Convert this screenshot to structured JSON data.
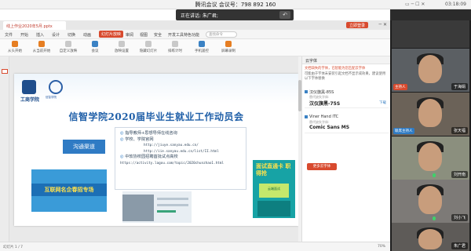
{
  "meeting": {
    "title": "腾讯会议 会议号：798 892 160",
    "clock": "03:18:09",
    "speaking_label": "正在讲话: 朱广君;"
  },
  "wps": {
    "doc_tab": "线上作业2020年5月.pptx",
    "right_tab_btn": "立即登录",
    "menu": [
      "文件",
      "开始",
      "插入",
      "设计",
      "切换",
      "动画",
      "幻灯片放映",
      "审阅",
      "视图",
      "安全",
      "开发工具",
      "特色功能"
    ],
    "menu_active_index": 6,
    "search_placeholder": "查找命令",
    "tools": [
      "从头开始",
      "从当前开始",
      "自定义放映",
      "会议",
      "放映设置",
      "隐藏幻灯片",
      "排练计时",
      "手机遥控",
      "屏幕录制"
    ],
    "zoom": "70%",
    "status_left": "幻灯片 1 / 7"
  },
  "slide": {
    "logo_text_1": "工商学院",
    "logo_text_2": "信智学院",
    "title": "信智学院2020届毕业生就业工作动员会",
    "channel_button": "沟通渠道",
    "bullets": [
      "指导教师+思想导师在线咨询",
      "学校、学院官网"
    ],
    "urls": [
      "http://jiuye.sanyau.edu.cn/",
      "http://iie.sanyau.edu.cn/list/II.html"
    ],
    "bullet3": "中软协校园招聘首批试点高校",
    "url3": "https://activity.lagou.com/topic/2020chunzhao1.html",
    "banner_left_text": "互联网名企春招专场",
    "banner_right_text": "面试直通卡 职得抢",
    "banner_right_sub": "云端面试"
  },
  "font_panel": {
    "title": "云字体",
    "warning": "文档缺失的字体，已智能为您匹配云字体",
    "desc": "可能由于字体未安装引起文档不显示或效果，建议使用以下字体替换",
    "fonts": [
      {
        "name": "汉仪旗黑-85S",
        "sub": "替代缺失字体:",
        "pick": "汉仪旗黑-75S",
        "action": "下载"
      },
      {
        "name": "Viner Hand ITC",
        "sub": "替代缺失字体:",
        "pick": "Comic Sans MS",
        "action": ""
      }
    ],
    "button": "更多云字体"
  },
  "participants": [
    {
      "name": "于海娟",
      "role": "主持人",
      "role_color": "#d84a2e"
    },
    {
      "name": "张天福",
      "role": "联席主持人",
      "role_color": "#2f7bc4"
    },
    {
      "name": "刘开南",
      "role": "",
      "role_color": ""
    },
    {
      "name": "刘小飞",
      "role": "",
      "role_color": ""
    },
    {
      "name": "朱广君",
      "role": "",
      "role_color": ""
    }
  ]
}
